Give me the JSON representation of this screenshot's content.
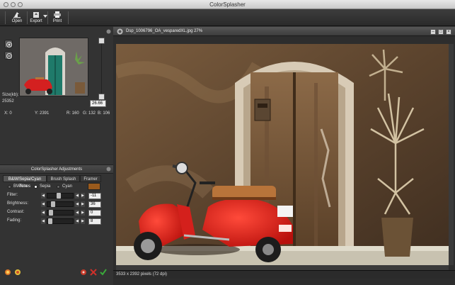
{
  "window": {
    "title": "ColorSplasher"
  },
  "toolbar": {
    "open_label": "Open",
    "export_label": "Export",
    "print_label": "Print"
  },
  "navigator": {
    "size_label": "Size(kb):",
    "size_value": "25352",
    "zoom_value": "26.66",
    "x_label": "X: 0",
    "y_label": "Y: 2391",
    "r_label": "R: 160",
    "g_label": "G: 132",
    "b_label": "B: 106"
  },
  "adjustments": {
    "title": "ColorSplasher Adjustments",
    "tabs": [
      "B&W/Sepia/Cyan Tones",
      "Brush Splash",
      "Framer"
    ],
    "tones": [
      "BWhite",
      "Sepia",
      "Cyan"
    ],
    "selected_tone": "Sepia",
    "tone_color": "#9a5a1c",
    "sliders": [
      {
        "label": "Filter:",
        "value": "-11",
        "level": 0.4
      },
      {
        "label": "Brightness:",
        "value": "36",
        "level": 0.15
      },
      {
        "label": "Contrast:",
        "value": "0",
        "level": 0.05
      },
      {
        "label": "Fading:",
        "value": "8",
        "level": 0.02
      }
    ]
  },
  "document": {
    "title": "Dsp_1006796_OA_vesparedXL.jpg 27%",
    "status": "3533 x 2392 pixels (72 dpi)"
  },
  "colors": {
    "accent_red": "#d8201c",
    "sepia": "#9a5a1c"
  },
  "icons": [
    "open-icon",
    "export-icon",
    "print-icon",
    "zoom-in-icon",
    "zoom-out-icon",
    "splash-icon",
    "undo-icon",
    "apply-icon"
  ]
}
